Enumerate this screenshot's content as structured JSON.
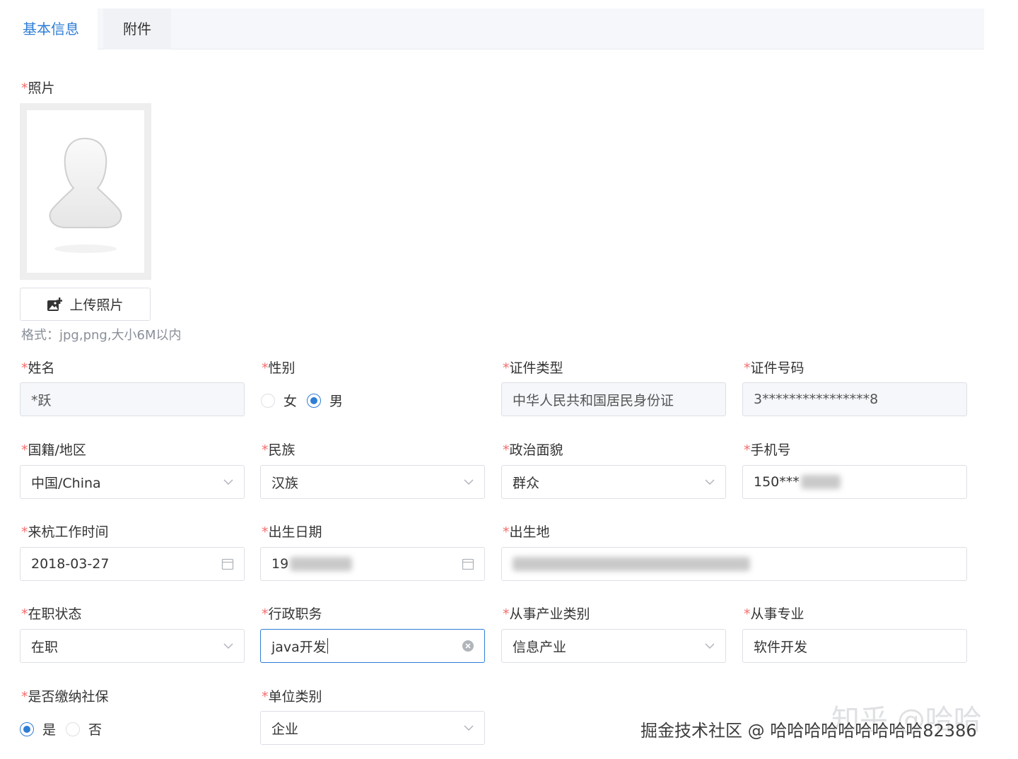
{
  "tabs": [
    {
      "label": "基本信息",
      "active": true
    },
    {
      "label": "附件",
      "active": false
    }
  ],
  "accent_color": "#2e7dd7",
  "required_mark": "*",
  "photo": {
    "label": "照片",
    "upload_label": "上传照片",
    "hint": "格式：jpg,png,大小6M以内"
  },
  "fields": {
    "name": {
      "label": "姓名",
      "value": "*跃"
    },
    "gender": {
      "label": "性别",
      "options": [
        "女",
        "男"
      ],
      "selected": "男"
    },
    "id_type": {
      "label": "证件类型",
      "value": "中华人民共和国居民身份证"
    },
    "id_number": {
      "label": "证件号码",
      "value": "3****************8"
    },
    "nationality": {
      "label": "国籍/地区",
      "value": "中国/China"
    },
    "ethnicity": {
      "label": "民族",
      "value": "汉族"
    },
    "political": {
      "label": "政治面貌",
      "value": "群众"
    },
    "phone": {
      "label": "手机号",
      "value": "150***"
    },
    "hangzhou_date": {
      "label": "来杭工作时间",
      "value": "2018-03-27"
    },
    "birth_date": {
      "label": "出生日期",
      "value": "19"
    },
    "birthplace": {
      "label": "出生地"
    },
    "employment": {
      "label": "在职状态",
      "value": "在职"
    },
    "admin_position": {
      "label": "行政职务",
      "value": "java开发"
    },
    "industry": {
      "label": "从事产业类别",
      "value": "信息产业"
    },
    "major": {
      "label": "从事专业",
      "value": "软件开发"
    },
    "social_security": {
      "label": "是否缴纳社保",
      "options": [
        "是",
        "否"
      ],
      "selected": "是"
    },
    "unit_type": {
      "label": "单位类别",
      "value": "企业"
    }
  },
  "watermark": {
    "juejin": "掘金技术社区 @ 哈哈哈哈哈哈哈哈哈82386",
    "zhihu": "知乎 @哈哈"
  },
  "icons": [
    "image-add-icon",
    "chevron-down-icon",
    "calendar-icon",
    "clear-icon",
    "avatar-placeholder"
  ]
}
